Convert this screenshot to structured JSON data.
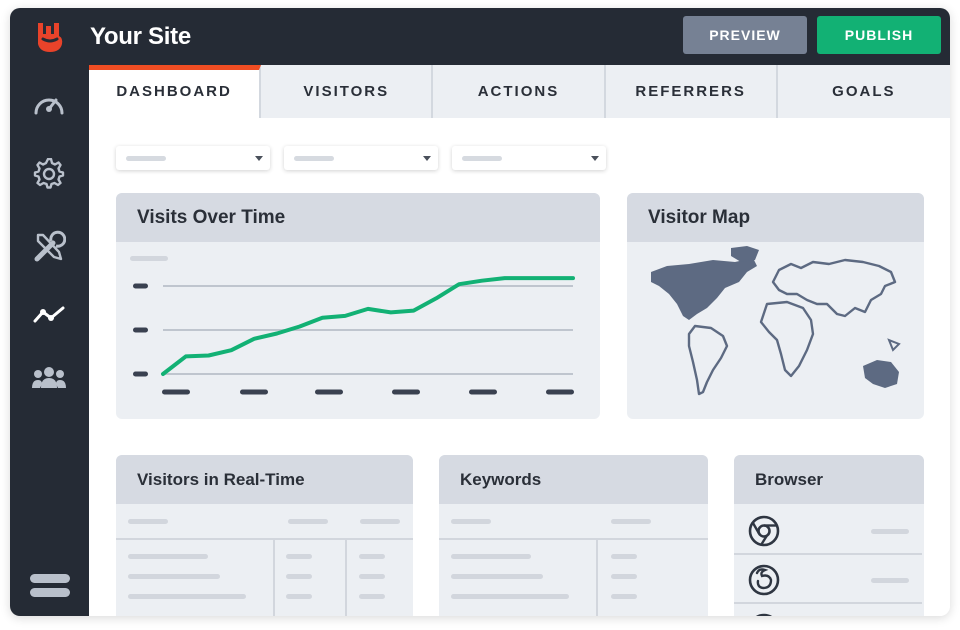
{
  "header": {
    "site_title": "Your Site",
    "preview_label": "PREVIEW",
    "publish_label": "PUBLISH",
    "logo_icon": "rock-hand-logo-icon"
  },
  "colors": {
    "dark": "#252b35",
    "accent_orange": "#f04d23",
    "publish_green": "#12b174",
    "preview_gray": "#768194",
    "line_green": "#12b174"
  },
  "sidebar": {
    "items": [
      {
        "icon": "speedometer-icon"
      },
      {
        "icon": "gear-icon"
      },
      {
        "icon": "tools-icon"
      },
      {
        "icon": "analytics-line-icon"
      },
      {
        "icon": "users-group-icon"
      },
      {
        "icon": "menu-toggle-icon"
      }
    ]
  },
  "tabs": [
    {
      "label": "DASHBOARD",
      "active": true
    },
    {
      "label": "VISITORS",
      "active": false
    },
    {
      "label": "ACTIONS",
      "active": false
    },
    {
      "label": "REFERRERS",
      "active": false
    },
    {
      "label": "GOALS",
      "active": false
    }
  ],
  "cards": {
    "visits": {
      "title": "Visits Over Time"
    },
    "map": {
      "title": "Visitor Map"
    },
    "realtime": {
      "title": "Visitors in Real-Time"
    },
    "keywords": {
      "title": "Keywords"
    },
    "browser": {
      "title": "Browser",
      "icons": [
        "chrome-icon",
        "firefox-icon",
        "browser-icon"
      ]
    }
  },
  "chart_data": {
    "type": "line",
    "title": "Visits Over Time",
    "x": [
      0,
      1,
      2,
      3,
      4,
      5,
      6,
      7,
      8,
      9,
      10,
      11,
      12,
      13,
      14,
      15,
      16,
      17,
      18
    ],
    "series": [
      {
        "values": [
          0,
          20,
          21,
          27,
          40,
          46,
          54,
          64,
          66,
          74,
          70,
          72,
          86,
          102,
          106,
          109,
          109,
          109,
          109
        ]
      }
    ],
    "ylim": [
      0,
      100
    ],
    "grid": true
  }
}
